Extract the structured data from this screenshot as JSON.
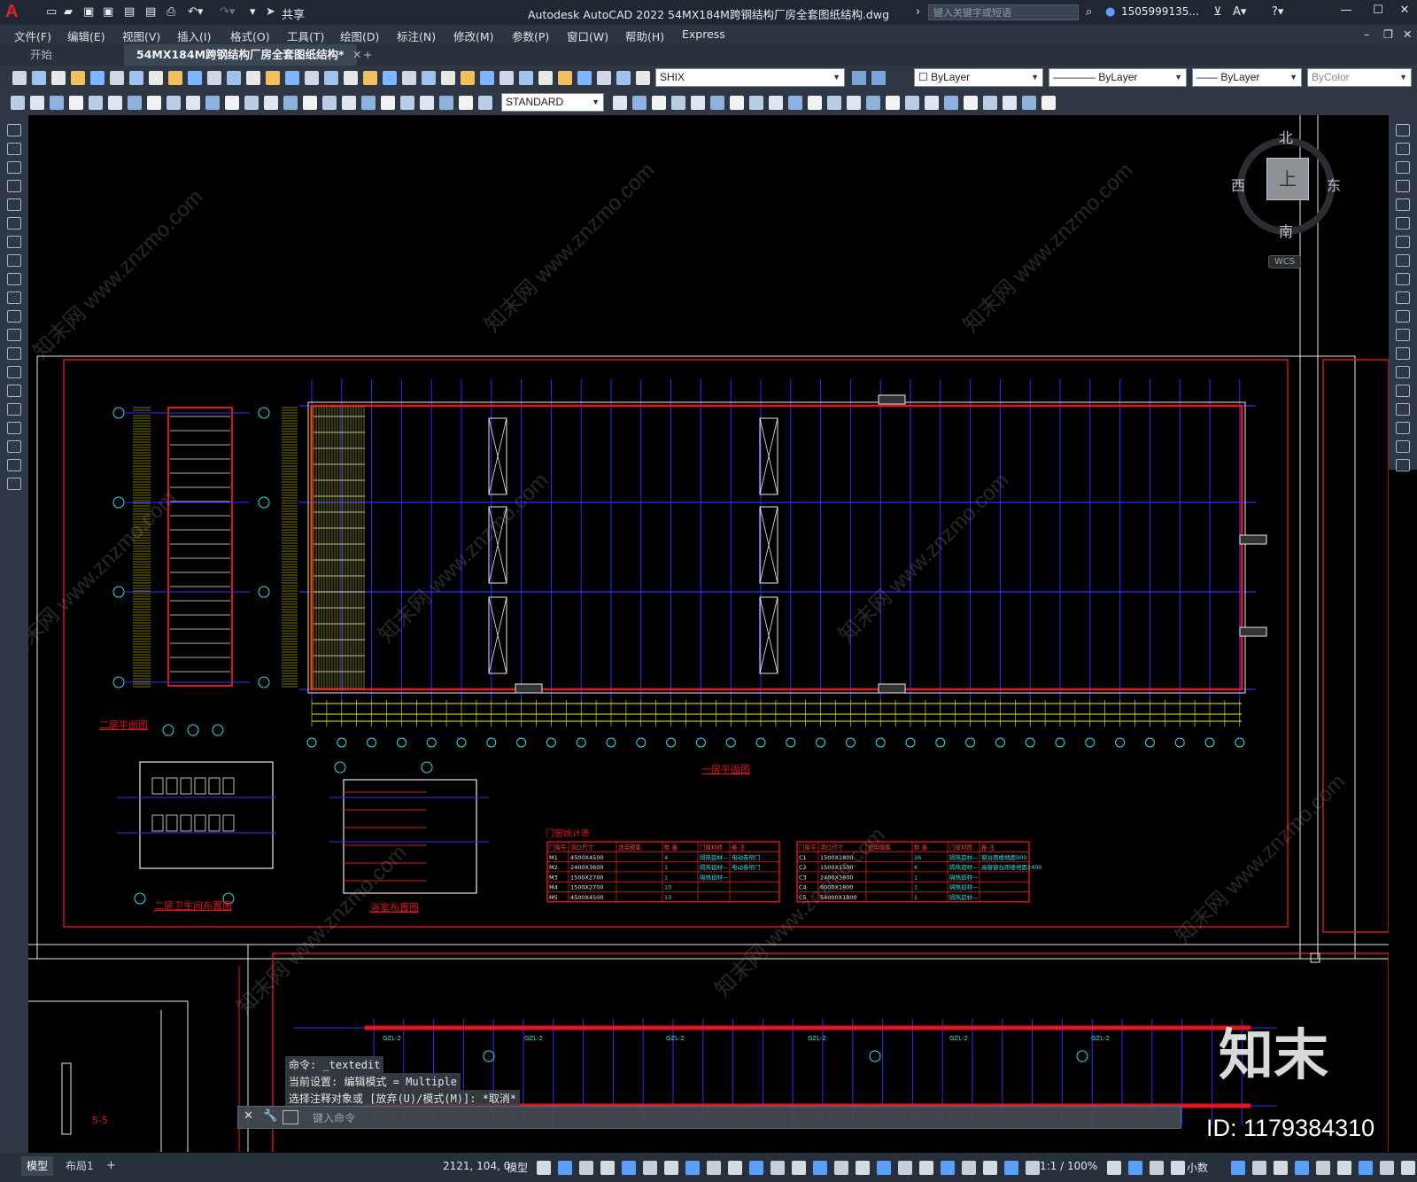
{
  "app": {
    "title": "Autodesk AutoCAD 2022    54MX184M跨钢结构厂房全套图纸结构.dwg",
    "share": "共享",
    "search_placeholder": "键入关键字或短语",
    "user": "1505999135...",
    "logo": "A"
  },
  "menu": [
    "文件(F)",
    "编辑(E)",
    "视图(V)",
    "插入(I)",
    "格式(O)",
    "工具(T)",
    "绘图(D)",
    "标注(N)",
    "修改(M)",
    "参数(P)",
    "窗口(W)",
    "帮助(H)",
    "Express"
  ],
  "tabs": [
    "开始",
    "54MX184M跨钢结构厂房全套图纸结构*",
    "+"
  ],
  "toolbar1": {
    "font": "SHIX",
    "layer_color": "ByLayer",
    "linetype": "ByLayer",
    "lineweight": "ByLayer",
    "plotstyle": "ByColor"
  },
  "toolbar2": {
    "textstyle": "STANDARD"
  },
  "viewcube": {
    "n": "北",
    "s": "南",
    "e": "东",
    "w": "西",
    "face": "上",
    "wcs": "WCS"
  },
  "drawing": {
    "plan1_title": "一层平面图",
    "plan2_title": "二层平面图",
    "toilet_title": "二层卫生间布置图",
    "bath_title": "浴室布置图",
    "door_table": {
      "title": "门窗统计表",
      "headers": [
        "门窗号",
        "洞口尺寸",
        "选用图集",
        "数 量",
        "门窗材质",
        "备 注"
      ],
      "rows": [
        [
          "M1",
          "4500X4500",
          "",
          "4",
          "隔热铝材—",
          "电动卷帘门"
        ],
        [
          "M2",
          "2400X3600",
          "",
          "1",
          "隔热铝材—",
          "电动卷帘门"
        ],
        [
          "M3",
          "1500X2700",
          "",
          "1",
          "隔热铝材—",
          ""
        ],
        [
          "M4",
          "1500X2700",
          "",
          "10",
          "",
          ""
        ],
        [
          "M5",
          "4500X4500",
          "",
          "13",
          "",
          ""
        ]
      ]
    },
    "window_table": {
      "headers": [
        "门窗号",
        "洞口尺寸",
        "选用图集",
        "数 量",
        "门窗材质",
        "备 注"
      ],
      "rows": [
        [
          "C1",
          "1500X1800",
          "",
          "26",
          "隔热铝材—",
          "窗台距楼地面900"
        ],
        [
          "C2",
          "1500X1500",
          "",
          "6",
          "隔热铝材—",
          "高窗窗台距楼地面2400"
        ],
        [
          "C3",
          "2400X1800",
          "",
          "1",
          "隔热铝材—",
          ""
        ],
        [
          "C4",
          "6000X1800",
          "",
          "1",
          "隔热铝材—",
          ""
        ],
        [
          "C5",
          "54000X1800",
          "",
          "1",
          "隔热铝材—",
          ""
        ]
      ]
    },
    "section_label": "5-5",
    "beam_labels": [
      "GZL-2",
      "GZL-2",
      "GZL-2",
      "GZL-2",
      "GZL-2",
      "GZL-2",
      "GZL-2"
    ]
  },
  "command": {
    "line1": "命令:  _textedit",
    "line2": "当前设置: 编辑模式 = Multiple",
    "line3": "选择注释对象或 [放弃(U)/模式(M)]: *取消*",
    "placeholder": "键入命令"
  },
  "layout_tabs": [
    "模型",
    "布局1",
    "+"
  ],
  "status": {
    "coords": "2121, 104, 0",
    "model": "模型",
    "scale": "1:1 / 100%",
    "units": "小数"
  },
  "watermark": {
    "brand": "知末",
    "id": "ID: 1179384310",
    "site": "知末网 www.znzmo.com"
  },
  "colors": {
    "frame_red": "#e0141e",
    "grid_blue": "#2f2cff",
    "dim_yellow": "#f2f20a",
    "text_cyan": "#2de0e8",
    "wall_white": "#e8e8e8",
    "accent": "#2f7fd8"
  }
}
